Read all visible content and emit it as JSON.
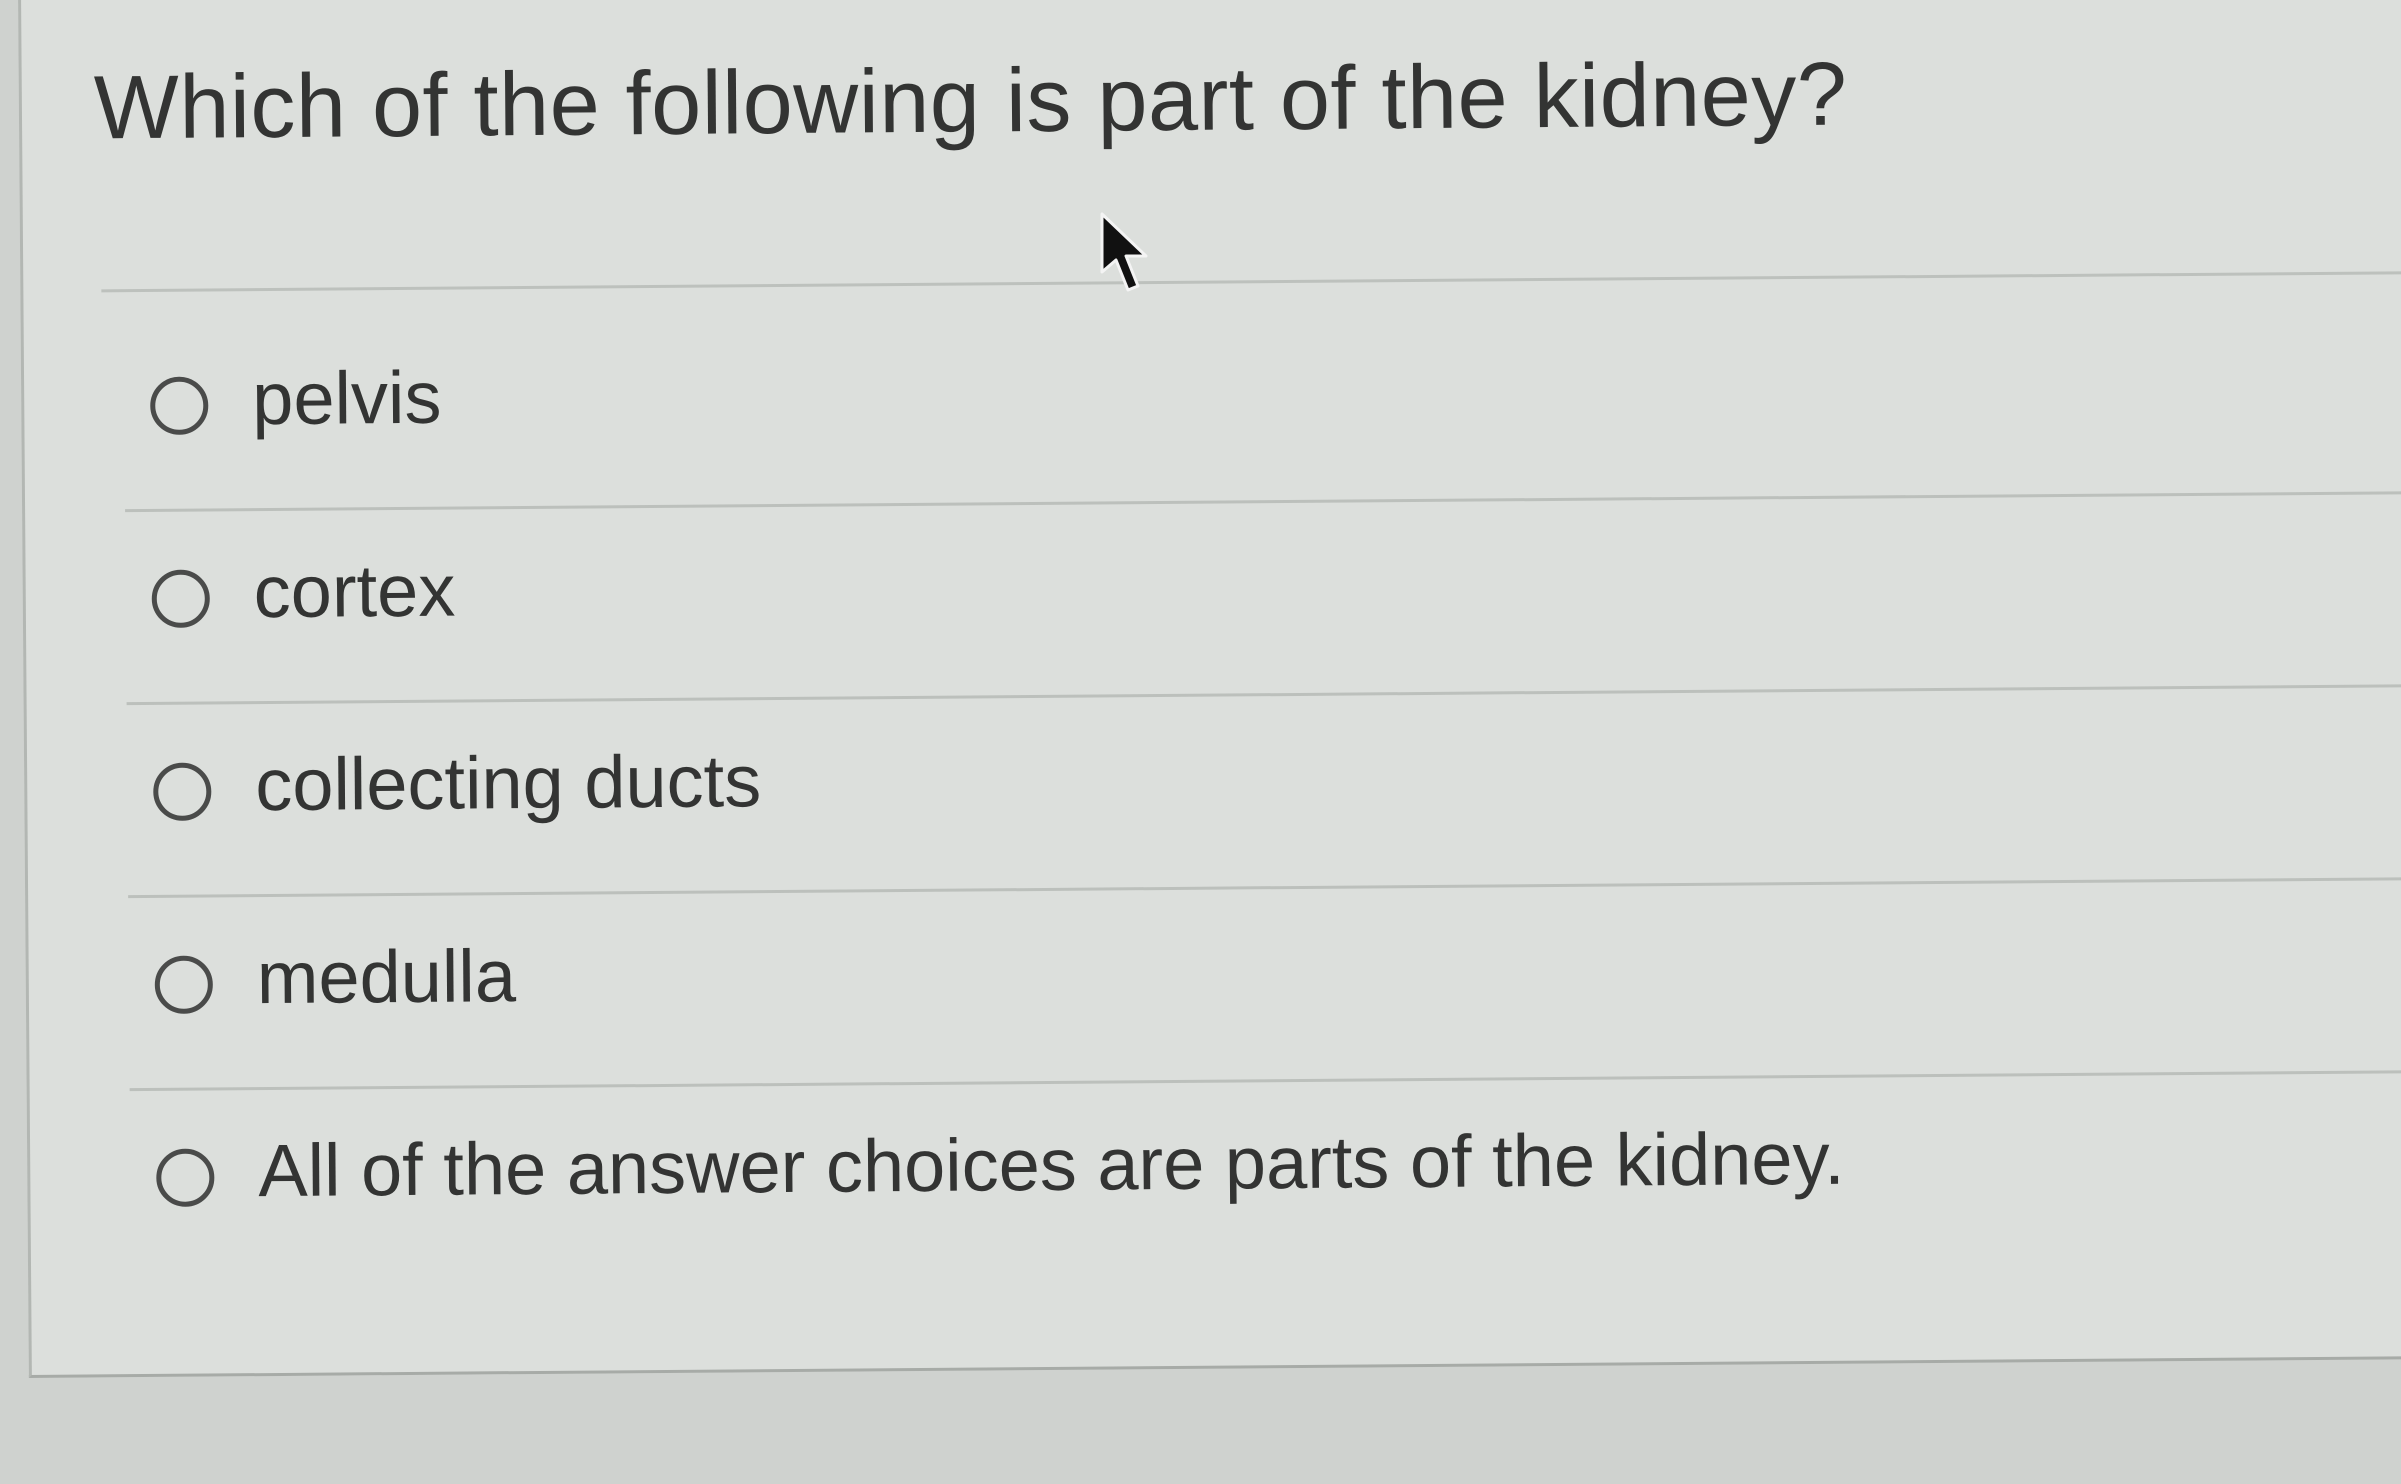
{
  "question": {
    "text": "Which of the following is part of the kidney?"
  },
  "choices": [
    {
      "label": "pelvis",
      "selected": false
    },
    {
      "label": "cortex",
      "selected": false
    },
    {
      "label": "collecting ducts",
      "selected": false
    },
    {
      "label": "medulla",
      "selected": false
    },
    {
      "label": "All of the answer choices are parts of the kidney.",
      "selected": false
    }
  ],
  "cursor": {
    "icon": "mouse-pointer-icon"
  },
  "colors": {
    "background": "#dcdfdc",
    "text": "#333433",
    "radio_border": "#4a4b4a",
    "divider": "#bcc0bc"
  }
}
